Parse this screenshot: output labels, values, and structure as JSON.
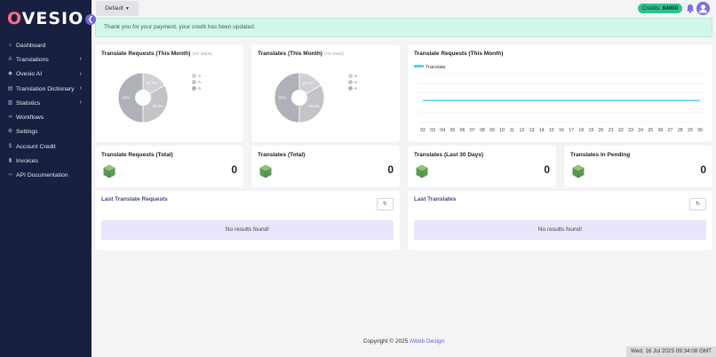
{
  "brand": {
    "logo_text_1": "O",
    "logo_text_2": "VESIO"
  },
  "sidebar": {
    "items": [
      {
        "label": "Dashboard",
        "icon": "home-icon",
        "has_children": false
      },
      {
        "label": "Translations",
        "icon": "translate-icon",
        "has_children": true
      },
      {
        "label": "Ovesio AI",
        "icon": "ai-icon",
        "has_children": true
      },
      {
        "label": "Translation Dictionary",
        "icon": "book-icon",
        "has_children": true
      },
      {
        "label": "Statistics",
        "icon": "chart-icon",
        "has_children": true
      },
      {
        "label": "Workflows",
        "icon": "share-icon",
        "has_children": false
      },
      {
        "label": "Settings",
        "icon": "gear-icon",
        "has_children": false
      },
      {
        "label": "Account Credit",
        "icon": "dollar-icon",
        "has_children": false
      },
      {
        "label": "Invoices",
        "icon": "file-icon",
        "has_children": false
      },
      {
        "label": "API Documentation",
        "icon": "code-icon",
        "has_children": false
      }
    ]
  },
  "topbar": {
    "default_label": "Default",
    "credits_label": "Credits",
    "credits_value": "64000"
  },
  "alert": {
    "text": "Thank you for your payment, your credit has been updated."
  },
  "cards": {
    "requests_month": {
      "title": "Translate Requests (This Month)",
      "nodata": "(no data)",
      "legend": [
        "A",
        "A",
        "A"
      ]
    },
    "translates_month": {
      "title": "Translates (This Month)",
      "nodata": "(no data)",
      "legend": [
        "A",
        "A",
        "A"
      ]
    },
    "line_chart_title": "Translate Requests (This Month)",
    "requests_total": {
      "title": "Translate Requests (Total)",
      "value": "0"
    },
    "translates_total": {
      "title": "Translates (Total)",
      "value": "0"
    },
    "translates_30": {
      "title": "Translates (Last 30 Days)",
      "value": "0"
    },
    "translates_pending": {
      "title": "Translates In Pending",
      "value": "0"
    }
  },
  "chart_data": [
    {
      "type": "pie",
      "title": "Translate Requests (This Month)",
      "categories": [
        "A",
        "A",
        "A"
      ],
      "values": [
        50,
        16.7,
        33.3
      ],
      "labels": [
        "50%",
        "16.7%",
        "33.3%"
      ],
      "colors": [
        "#aeb1b7",
        "#cfd1d5",
        "#c2c4c8"
      ]
    },
    {
      "type": "pie",
      "title": "Translates (This Month)",
      "categories": [
        "A",
        "A",
        "A"
      ],
      "values": [
        50,
        16.7,
        33.3
      ],
      "labels": [
        "50%",
        "16.7%",
        "33.3%"
      ],
      "colors": [
        "#aeb1b7",
        "#cfd1d5",
        "#c2c4c8"
      ]
    },
    {
      "type": "line",
      "title": "Translate Requests (This Month)",
      "series": [
        {
          "name": "Translate",
          "values": [
            0,
            0,
            0,
            0,
            0,
            0,
            0,
            0,
            0,
            0,
            0,
            0,
            0,
            0,
            0,
            0,
            0,
            0,
            0,
            0,
            0,
            0,
            0,
            0,
            0,
            0,
            0,
            0,
            0
          ]
        }
      ],
      "categories": [
        "02",
        "03",
        "04",
        "05",
        "06",
        "07",
        "08",
        "09",
        "10",
        "11",
        "12",
        "13",
        "14",
        "15",
        "16",
        "17",
        "18",
        "19",
        "20",
        "21",
        "22",
        "23",
        "24",
        "25",
        "26",
        "27",
        "28",
        "29",
        "30"
      ],
      "color": "#5ad1dc"
    }
  ],
  "last_requests": {
    "title": "Last Translate Requests",
    "empty": "No results found!"
  },
  "last_translates": {
    "title": "Last Translates",
    "empty": "No results found!"
  },
  "footer": {
    "copyright": "Copyright © 2025",
    "company": "AWeb Design"
  },
  "clock": "Wed, 16 Jul 2025 09:34:08 GMT"
}
